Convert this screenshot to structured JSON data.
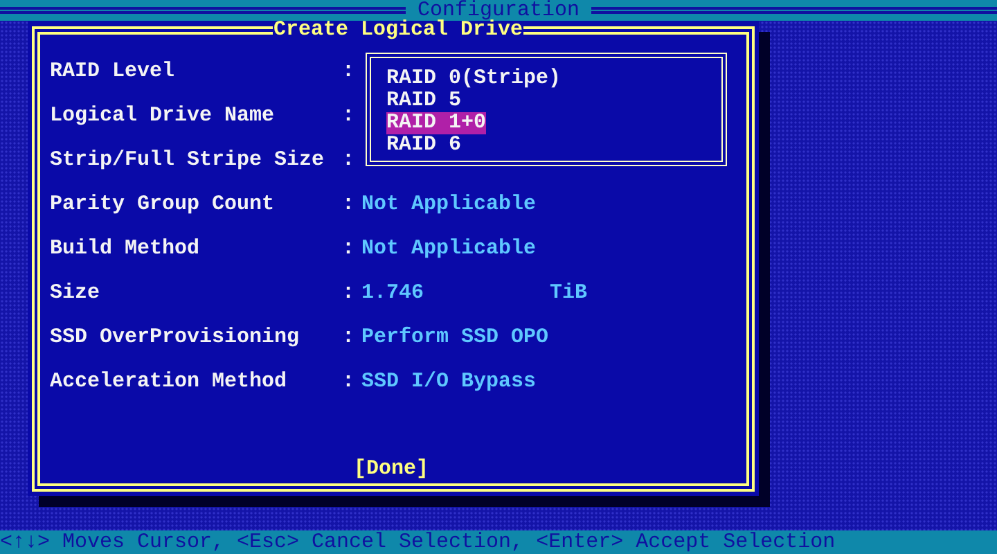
{
  "top_bar": {
    "title": "Configuration"
  },
  "dialog": {
    "title": "Create Logical Drive",
    "fields": [
      {
        "label": "RAID Level",
        "separator": ":"
      },
      {
        "label": "Logical Drive Name",
        "separator": ":"
      },
      {
        "label": "Strip/Full Stripe Size",
        "separator": ":"
      },
      {
        "label": "Parity Group Count",
        "separator": ":",
        "value": "Not Applicable"
      },
      {
        "label": "Build Method",
        "separator": ":",
        "value": "Not Applicable"
      },
      {
        "label": "Size",
        "separator": ":",
        "value": "1.746",
        "unit": "TiB"
      },
      {
        "label": "SSD OverProvisioning",
        "separator": ":",
        "value": "Perform SSD OPO"
      },
      {
        "label": "Acceleration Method",
        "separator": ":",
        "value": "SSD I/O Bypass"
      }
    ],
    "dropdown": {
      "options": [
        {
          "label": "RAID 0(Stripe)",
          "selected": false
        },
        {
          "label": "RAID 5",
          "selected": false
        },
        {
          "label": "RAID 1+0",
          "selected": true
        },
        {
          "label": "RAID 6",
          "selected": false
        }
      ]
    },
    "done_button": "[Done]"
  },
  "status_bar": "<↑↓> Moves Cursor, <Esc> Cancel Selection, <Enter> Accept Selection"
}
